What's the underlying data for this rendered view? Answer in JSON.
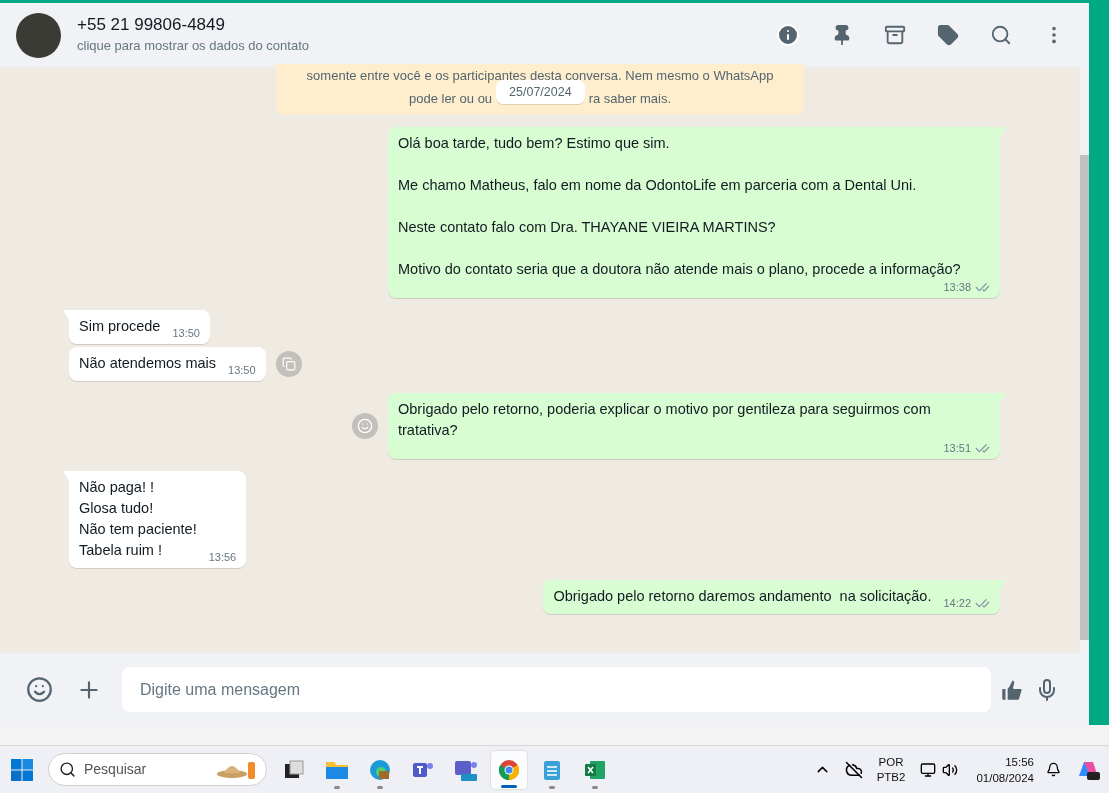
{
  "header": {
    "contact_name": "+55 21 99806-4849",
    "subtitle": "clique para mostrar os dados do contato"
  },
  "notice": {
    "lines": [
      "somente entre você e os participantes desta conversa. Nem mesmo o WhatsApp",
      "pode ler ou ou",
      "ra saber mais."
    ],
    "date": "25/07/2024"
  },
  "messages": [
    {
      "kind": "out",
      "text": "Olá boa tarde, tudo bem? Estimo que sim.\n\nMe chamo Matheus, falo em nome da OdontoLife em parceria com a Dental Uni.\n\nNeste contato falo com Dra. THAYANE VIEIRA MARTINS?\n\nMotivo do contato seria que a doutora não atende mais o plano, procede a informação?",
      "time": "13:38",
      "tail": true
    },
    {
      "kind": "in",
      "text": "Sim procede",
      "time": "13:50",
      "tail": true
    },
    {
      "kind": "in",
      "text": "Não atendemos mais",
      "time": "13:50",
      "tail": false,
      "hovered": true
    },
    {
      "kind": "out",
      "text": "Obrigado pelo retorno, poderia explicar o motivo por gentileza para seguirmos com tratativa?",
      "time": "13:51",
      "tail": true,
      "hovered": true
    },
    {
      "kind": "in",
      "text": "Não paga! !\nGlosa tudo!\nNão tem paciente!\nTabela ruim !",
      "time": "13:56",
      "tail": true
    },
    {
      "kind": "out",
      "text": "Obrigado pelo retorno daremos andamento  na solicitação.",
      "time": "14:22",
      "tail": true
    }
  ],
  "composer": {
    "placeholder": "Digite uma mensagem"
  },
  "taskbar": {
    "search_placeholder": "Pesquisar",
    "apps": [
      {
        "kind": "taskview",
        "selected": false,
        "running": false
      },
      {
        "kind": "files",
        "selected": false,
        "running": true
      },
      {
        "kind": "edge",
        "selected": false,
        "running": true
      },
      {
        "kind": "teams",
        "selected": false,
        "running": false
      },
      {
        "kind": "teamsnew",
        "selected": false,
        "running": false
      },
      {
        "kind": "chrome",
        "selected": true,
        "running": true
      },
      {
        "kind": "notepad",
        "selected": false,
        "running": true
      },
      {
        "kind": "excel",
        "selected": false,
        "running": true
      }
    ],
    "language": "POR",
    "layout": "PTB2",
    "time": "15:56",
    "date": "01/08/2024"
  }
}
